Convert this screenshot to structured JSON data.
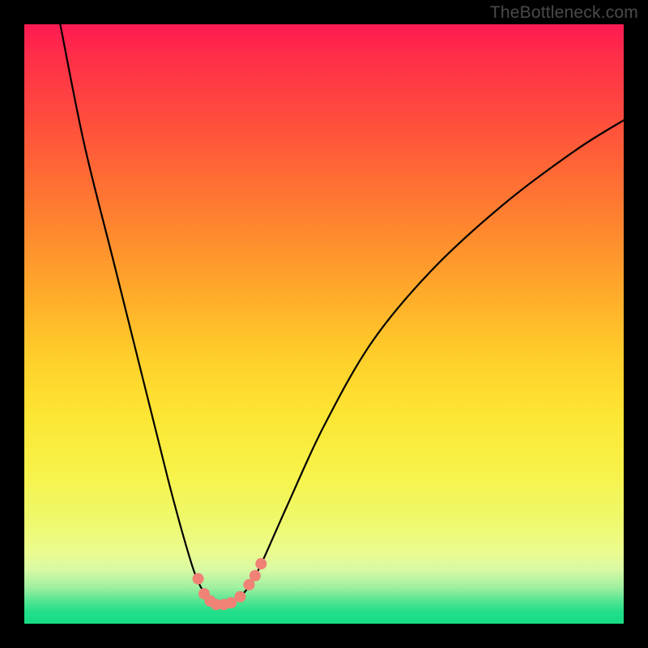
{
  "watermark": "TheBottleneck.com",
  "chart_data": {
    "type": "line",
    "title": "",
    "xlabel": "",
    "ylabel": "",
    "xlim": [
      0,
      100
    ],
    "ylim": [
      0,
      100
    ],
    "grid": false,
    "series": [
      {
        "name": "curve",
        "color": "#000000",
        "x": [
          6,
          10,
          15,
          20,
          24,
          27,
          29,
          31,
          32.5,
          34,
          36,
          38,
          40,
          44,
          50,
          58,
          68,
          80,
          92,
          100
        ],
        "y": [
          100,
          80,
          60,
          40,
          24,
          13,
          7,
          4,
          3,
          3.5,
          4.5,
          7,
          11,
          20,
          33,
          47,
          59,
          70,
          79,
          84
        ]
      }
    ],
    "markers": [
      {
        "x": 29.0,
        "y": 7.5
      },
      {
        "x": 30.0,
        "y": 5.0
      },
      {
        "x": 31.0,
        "y": 3.8
      },
      {
        "x": 32.0,
        "y": 3.2
      },
      {
        "x": 33.3,
        "y": 3.2
      },
      {
        "x": 34.5,
        "y": 3.5
      },
      {
        "x": 36.0,
        "y": 4.5
      },
      {
        "x": 37.5,
        "y": 6.5
      },
      {
        "x": 38.5,
        "y": 8.0
      },
      {
        "x": 39.5,
        "y": 10.0
      }
    ],
    "marker_color": "#f08276",
    "marker_radius": 7
  }
}
